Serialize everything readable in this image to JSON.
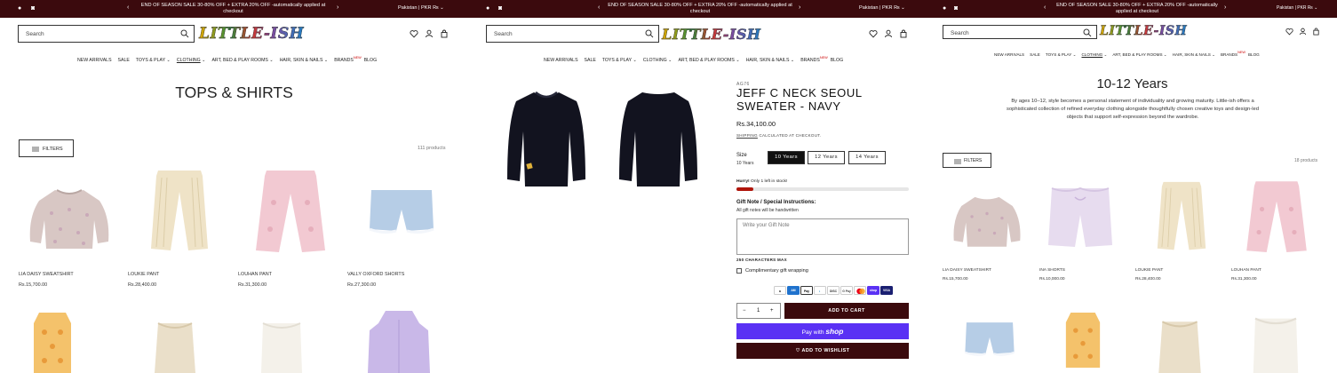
{
  "colors": {
    "accent": "#3b0a0d",
    "shoppay": "#5a31f4",
    "stock": "#b0150b"
  },
  "announcement": {
    "message": "END OF SEASON SALE 30-80% OFF + EXTRA 20% OFF -automatically applied at checkout",
    "region": "Pakistan | PKR ₨",
    "prev_icon": "chevron-left-icon",
    "next_icon": "chevron-right-icon",
    "facebook_icon": "facebook-icon",
    "instagram_icon": "instagram-icon"
  },
  "header": {
    "search_placeholder": "Search",
    "logo": "LITTLE-ISH",
    "icons": [
      "heart-icon",
      "user-icon",
      "bag-icon"
    ]
  },
  "nav": {
    "items": [
      "NEW ARRIVALS",
      "SALE",
      "TOYS & PLAY",
      "CLOTHING",
      "ART, BED & PLAY ROOMS",
      "HAIR, SKIN & NAILS",
      "BRANDS",
      "BLOG"
    ],
    "new_badge": "NEW"
  },
  "collection_tops": {
    "title": "TOPS & SHIRTS",
    "filters_label": "FILTERS",
    "count": "111 products",
    "products": [
      {
        "name": "LIA DAISY SWEATSHIRT",
        "price": "Rs.15,700.00"
      },
      {
        "name": "LOUKIE PANT",
        "price": "Rs.28,400.00"
      },
      {
        "name": "LOUHAN PANT",
        "price": "Rs.31,300.00"
      },
      {
        "name": "VALLY OXFORD SHORTS",
        "price": "Rs.27,300.00"
      }
    ]
  },
  "product": {
    "sku": "AG76",
    "title": "JEFF C NECK SEOUL SWEATER - NAVY",
    "price": "Rs.34,100.00",
    "shipping_link": "SHIPPING",
    "shipping_rest": " CALCULATED AT CHECKOUT.",
    "size_label": "Size",
    "size_selected": "10 Years",
    "sizes": [
      "10 Years",
      "12 Years",
      "14 Years"
    ],
    "stock_hurry": "Hurry!",
    "stock_text": " Only 1 left in stock!",
    "stock_fraction": 0.1,
    "gift_label": "Gift Note / Special Instructions:",
    "gift_sub": "All gift notes will be handwritten",
    "gift_placeholder": "Write your Gift Note",
    "chars_max": "250 CHARACTERS MAX",
    "wrapping_label": "Complimentary gift wrapping",
    "payment_methods": [
      "Amazon",
      "American Express",
      "Apple Pay",
      "Diners Club",
      "Discover",
      "Google Pay",
      "Mastercard",
      "Shop Pay",
      "Visa"
    ],
    "qty_minus": "−",
    "qty": "1",
    "qty_plus": "+",
    "add_to_cart": "ADD TO CART",
    "pay_with": "Pay with",
    "shop_word": "shop",
    "add_to_wishlist": "ADD TO WISHLIST"
  },
  "collection_age": {
    "title": "10-12 Years",
    "description": "By ages 10–12, style becomes a personal statement of individuality and growing maturity. Little-ish offers a sophisticated collection of refined everyday clothing alongside thoughtfully chosen creative toys and design-led objects that support self-expression beyond the wardrobe.",
    "filters_label": "FILTERS",
    "count": "18 products",
    "products": [
      {
        "name": "LIA DAISY SWEATSHIRT",
        "price": "Rs.15,700.00"
      },
      {
        "name": "INA SHORTS",
        "price": "Rs.10,000.00"
      },
      {
        "name": "LOUKIE PANT",
        "price": "Rs.28,400.00"
      },
      {
        "name": "LOUHAN PANT",
        "price": "Rs.31,300.00"
      }
    ]
  }
}
